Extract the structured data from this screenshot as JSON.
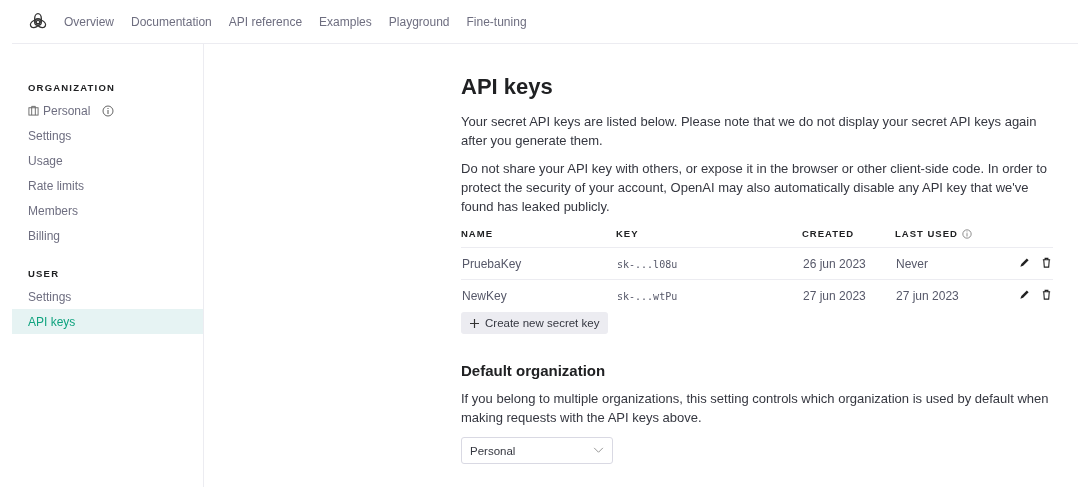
{
  "nav": {
    "links": [
      {
        "label": "Overview"
      },
      {
        "label": "Documentation"
      },
      {
        "label": "API reference"
      },
      {
        "label": "Examples"
      },
      {
        "label": "Playground"
      },
      {
        "label": "Fine-tuning"
      }
    ]
  },
  "sidebar": {
    "sections": [
      {
        "heading": "ORGANIZATION",
        "items": [
          {
            "label": "Personal",
            "kind": "org",
            "selected": false
          },
          {
            "label": "Settings",
            "kind": "link",
            "selected": false
          },
          {
            "label": "Usage",
            "kind": "link",
            "selected": false
          },
          {
            "label": "Rate limits",
            "kind": "link",
            "selected": false
          },
          {
            "label": "Members",
            "kind": "link",
            "selected": false
          },
          {
            "label": "Billing",
            "kind": "link",
            "selected": false
          }
        ]
      },
      {
        "heading": "USER",
        "items": [
          {
            "label": "Settings",
            "kind": "link",
            "selected": false
          },
          {
            "label": "API keys",
            "kind": "link",
            "selected": true
          }
        ]
      }
    ]
  },
  "page": {
    "title": "API keys",
    "paragraphs": [
      "Your secret API keys are listed below. Please note that we do not display your secret API keys again after you generate them.",
      "Do not share your API key with others, or expose it in the browser or other client-side code. In order to protect the security of your account, OpenAI may also automatically disable any API key that we've found has leaked publicly."
    ],
    "table": {
      "columns": [
        {
          "label": "NAME",
          "info": false
        },
        {
          "label": "KEY",
          "info": false
        },
        {
          "label": "CREATED",
          "info": false
        },
        {
          "label": "LAST USED",
          "info": true
        }
      ],
      "rows": [
        {
          "name": "PruebaKey",
          "key": "sk-...l08u",
          "created": "26 jun 2023",
          "last_used": "Never"
        },
        {
          "name": "NewKey",
          "key": "sk-...wtPu",
          "created": "27 jun 2023",
          "last_used": "27 jun 2023"
        }
      ]
    },
    "create_button": "Create new secret key",
    "default_org": {
      "heading": "Default organization",
      "text": "If you belong to multiple organizations, this setting controls which organization is used by default when making requests with the API keys above.",
      "value": "Personal"
    }
  }
}
